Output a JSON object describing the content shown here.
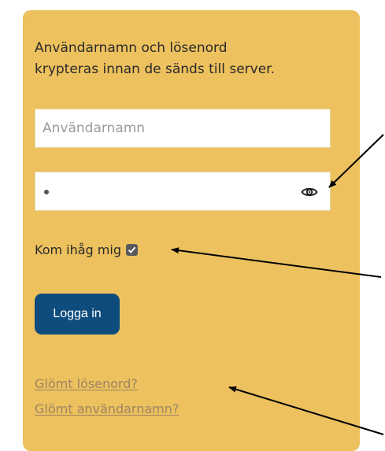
{
  "info": {
    "text": "Användarnamn och lösenord\nkrypteras innan de sänds till server."
  },
  "username": {
    "value": "",
    "placeholder": "Användarnamn"
  },
  "password": {
    "masked_value": "•",
    "toggle_icon": "eye-icon"
  },
  "remember": {
    "label": "Kom ihåg mig",
    "checked": true
  },
  "login": {
    "label": "Logga in"
  },
  "links": {
    "forgot_password": "Glömt lösenord?",
    "forgot_username": "Glömt användarnamn?"
  },
  "colors": {
    "panel": "#EDC15E",
    "button": "#0E4C7D",
    "link": "#9B8563",
    "annotation_arrows": "#000000"
  }
}
